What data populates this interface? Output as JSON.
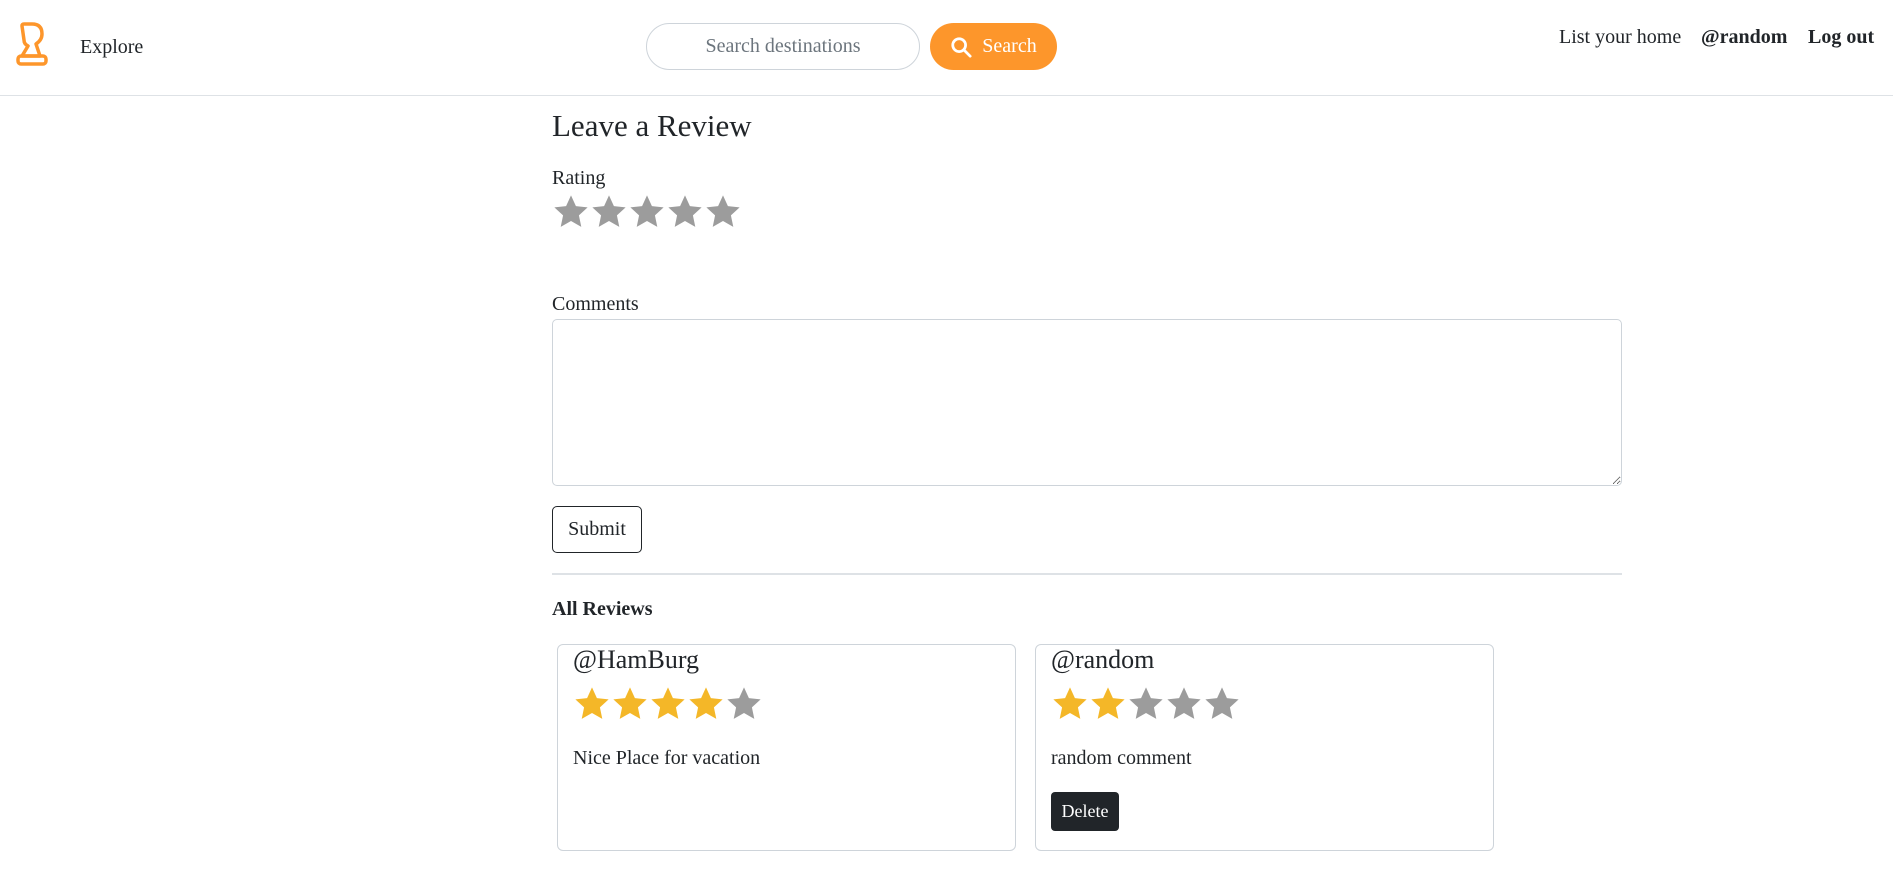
{
  "header": {
    "explore_label": "Explore",
    "search_placeholder": "Search destinations",
    "search_button_label": "Search",
    "list_home_label": "List your home",
    "username_label": "@random",
    "logout_label": "Log out"
  },
  "colors": {
    "accent": "#fd962b",
    "star_filled": "#f4b728",
    "star_empty": "#9c9c9c",
    "dark": "#212529"
  },
  "form": {
    "title": "Leave a Review",
    "rating_label": "Rating",
    "rating_value": 0,
    "rating_max": 5,
    "comments_label": "Comments",
    "comments_value": "",
    "submit_label": "Submit"
  },
  "reviews": {
    "heading": "All Reviews",
    "items": [
      {
        "user": "@HamBurg",
        "rating": 4,
        "comment": "Nice Place for vacation",
        "delete_label": ""
      },
      {
        "user": "@random",
        "rating": 2,
        "comment": "random comment",
        "delete_label": "Delete"
      }
    ]
  }
}
